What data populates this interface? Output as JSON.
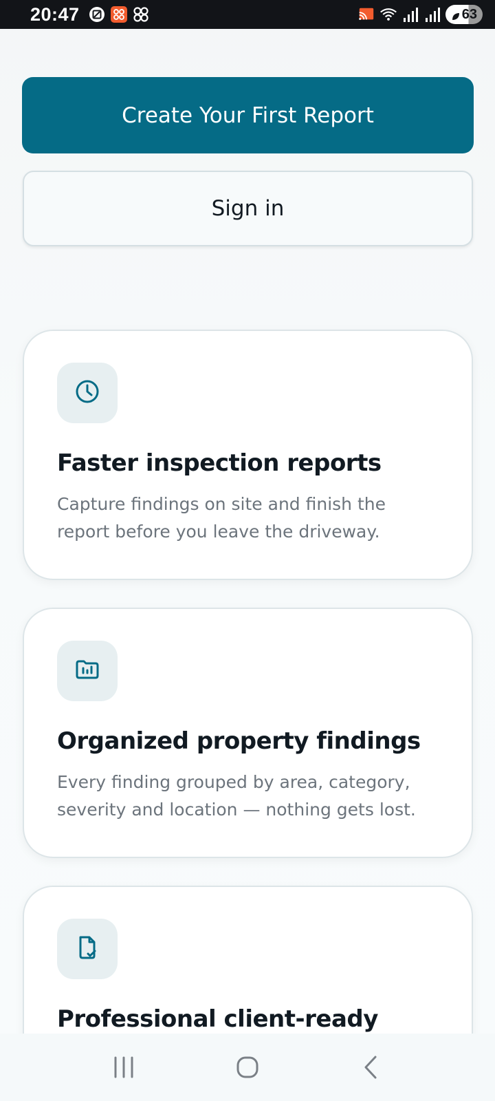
{
  "status_bar": {
    "time": "20:47",
    "left_icons": [
      "screenshot-icon",
      "app-notification-icon",
      "pinwheel-icon"
    ],
    "right_icons": [
      "cast-icon",
      "wifi-icon",
      "signal-icon",
      "signal-icon"
    ],
    "battery_level": "63"
  },
  "actions": {
    "primary_label": "Create Your First Report",
    "secondary_label": "Sign in"
  },
  "features": [
    {
      "icon": "clock-icon",
      "title": "Faster inspection reports",
      "description": "Capture findings on site and finish the report before you leave the driveway."
    },
    {
      "icon": "folder-chart-icon",
      "title": "Organized property findings",
      "description": "Every finding grouped by area, category, severity and location — nothing gets lost."
    },
    {
      "icon": "document-check-icon",
      "title": "Professional client-ready",
      "description": ""
    }
  ],
  "nav": {
    "items": [
      "recent-apps-icon",
      "home-icon",
      "back-icon"
    ]
  },
  "colors": {
    "accent": "#056b86",
    "icon_bg": "#e7eff1",
    "title": "#111a22",
    "body_text": "#6c747c",
    "card_border": "#dde5e8"
  }
}
